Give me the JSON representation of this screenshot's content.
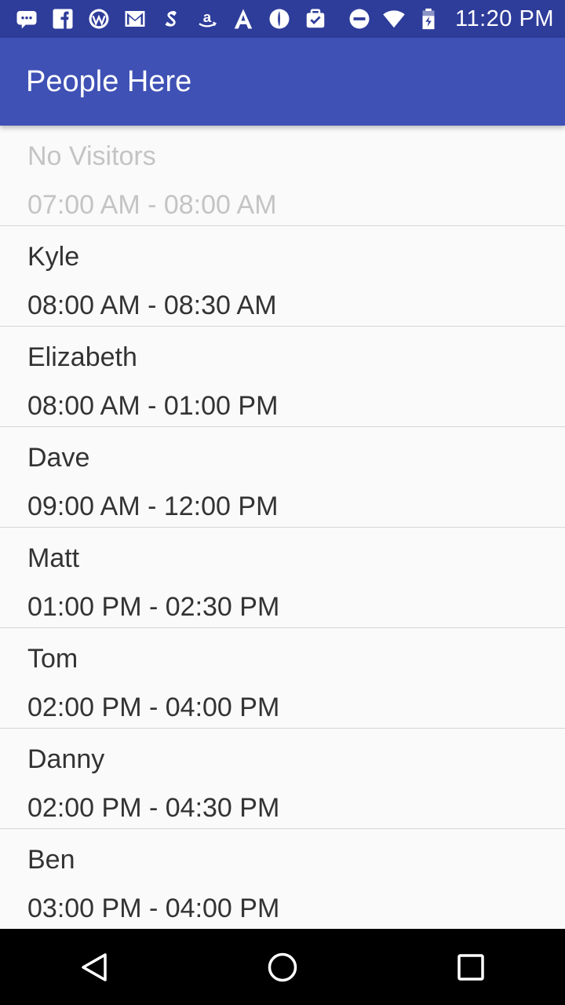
{
  "status_bar": {
    "time": "11:20 PM",
    "left_icons": [
      "chat-icon",
      "facebook-icon",
      "wordpress-icon",
      "gmail-icon",
      "shazam-icon",
      "amazon-icon",
      "font-a-icon",
      "disk-icon",
      "briefcase-check-icon"
    ],
    "right_icons": [
      "do-not-disturb-icon",
      "wifi-icon",
      "battery-icon"
    ]
  },
  "app_bar": {
    "title": "People Here"
  },
  "visits": [
    {
      "name": "No Visitors",
      "time": "07:00 AM - 08:00 AM",
      "disabled": true
    },
    {
      "name": "Kyle",
      "time": "08:00 AM - 08:30 AM"
    },
    {
      "name": "Elizabeth",
      "time": "08:00 AM - 01:00 PM"
    },
    {
      "name": "Dave",
      "time": "09:00 AM - 12:00 PM"
    },
    {
      "name": "Matt",
      "time": "01:00 PM - 02:30 PM"
    },
    {
      "name": "Tom",
      "time": "02:00 PM - 04:00 PM"
    },
    {
      "name": "Danny",
      "time": "02:00 PM - 04:30 PM"
    },
    {
      "name": "Ben",
      "time": "03:00 PM - 04:00 PM"
    }
  ],
  "nav_bar": {
    "buttons": [
      "back-icon",
      "home-icon",
      "recents-icon"
    ]
  },
  "colors": {
    "app_bar": "#3f51b5",
    "status_bar": "#2e3c9a",
    "text": "#333333",
    "disabled_text": "#c4c4c4"
  }
}
